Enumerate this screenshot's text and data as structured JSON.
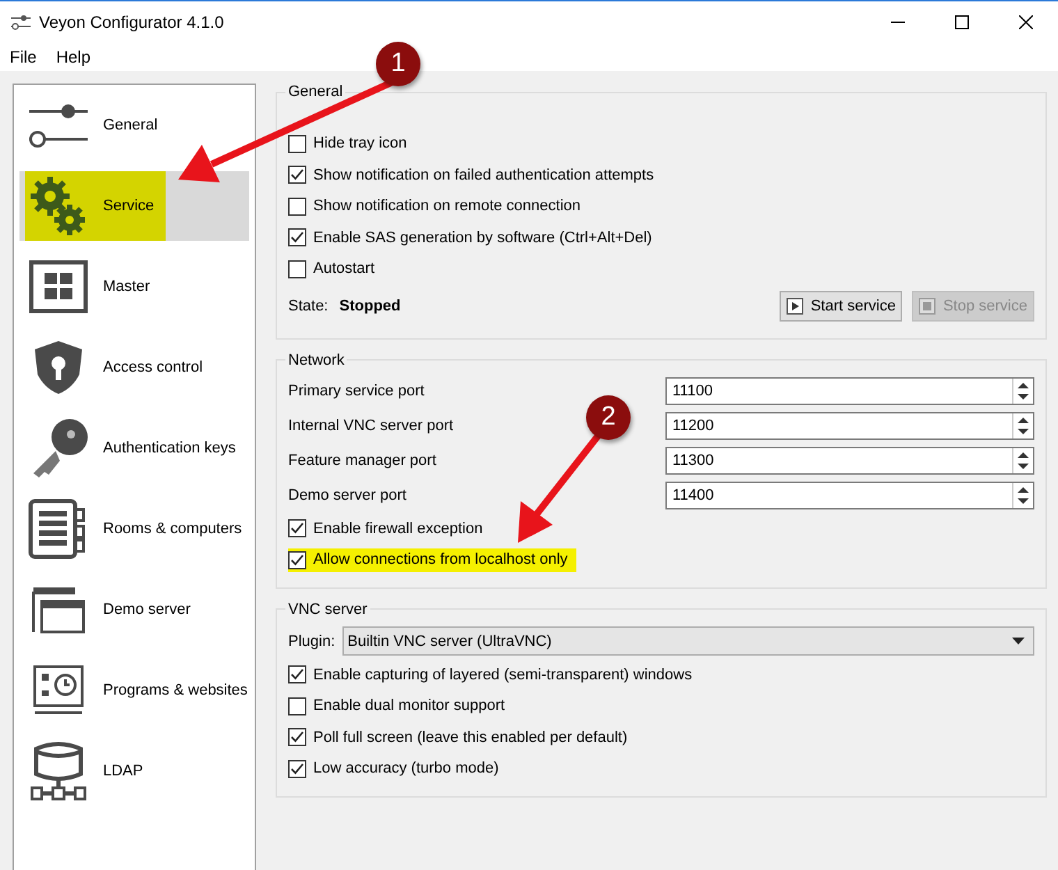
{
  "window": {
    "title": "Veyon Configurator 4.1.0"
  },
  "menu": [
    "File",
    "Help"
  ],
  "sidebar": {
    "items": [
      {
        "label": "General",
        "kind": "sliders",
        "selected": false,
        "highlighted": false
      },
      {
        "label": "Service",
        "kind": "gears",
        "selected": true,
        "highlighted": true
      },
      {
        "label": "Master",
        "kind": "grid",
        "selected": false,
        "highlighted": false
      },
      {
        "label": "Access control",
        "kind": "shield",
        "selected": false,
        "highlighted": false
      },
      {
        "label": "Authentication keys",
        "kind": "key",
        "selected": false,
        "highlighted": false
      },
      {
        "label": "Rooms & computers",
        "kind": "list",
        "selected": false,
        "highlighted": false
      },
      {
        "label": "Demo server",
        "kind": "windows",
        "selected": false,
        "highlighted": false
      },
      {
        "label": "Programs & websites",
        "kind": "clock",
        "selected": false,
        "highlighted": false
      },
      {
        "label": "LDAP",
        "kind": "database",
        "selected": false,
        "highlighted": false
      }
    ]
  },
  "general": {
    "title": "General",
    "options": [
      {
        "label": "Hide tray icon",
        "checked": false
      },
      {
        "label": "Show notification on failed authentication attempts",
        "checked": true
      },
      {
        "label": "Show notification on remote connection",
        "checked": false
      },
      {
        "label": "Enable SAS generation by software (Ctrl+Alt+Del)",
        "checked": true
      },
      {
        "label": "Autostart",
        "checked": false
      }
    ],
    "state_label": "State:",
    "state_value": "Stopped",
    "buttons": [
      {
        "label": "Start service",
        "kind": "play",
        "disabled": false
      },
      {
        "label": "Stop service",
        "kind": "stop",
        "disabled": true
      }
    ]
  },
  "network": {
    "title": "Network",
    "ports": [
      {
        "label": "Primary service port",
        "value": "11100"
      },
      {
        "label": "Internal VNC server port",
        "value": "11200"
      },
      {
        "label": "Feature manager port",
        "value": "11300"
      },
      {
        "label": "Demo server port",
        "value": "11400"
      }
    ],
    "options": [
      {
        "label": "Enable firewall exception",
        "checked": true,
        "highlighted": false
      },
      {
        "label": "Allow connections from localhost only",
        "checked": true,
        "highlighted": true
      }
    ]
  },
  "vnc_server": {
    "title": "VNC server",
    "plugin_label": "Plugin:",
    "plugin_value": "Builtin VNC server (UltraVNC)",
    "options": [
      {
        "label": "Enable capturing of layered (semi-transparent) windows",
        "checked": true
      },
      {
        "label": "Enable dual monitor support",
        "checked": false
      },
      {
        "label": "Poll full screen (leave this enabled per default)",
        "checked": true
      },
      {
        "label": "Low accuracy (turbo mode)",
        "checked": true
      }
    ]
  },
  "annotations": [
    {
      "number": "1"
    },
    {
      "number": "2"
    }
  ]
}
